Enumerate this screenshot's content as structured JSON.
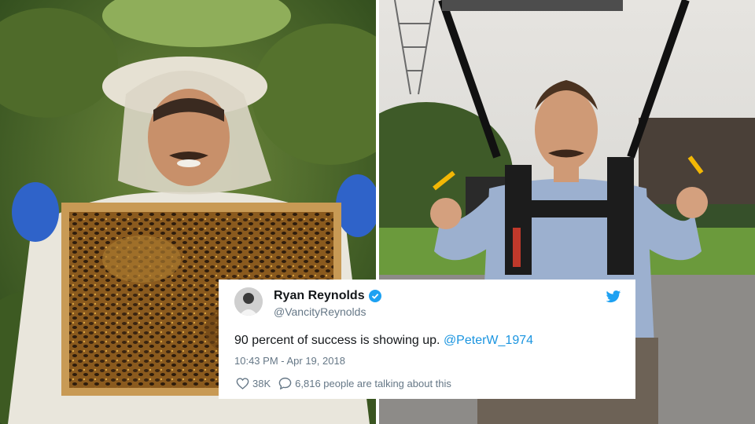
{
  "tweet": {
    "display_name": "Ryan Reynolds",
    "handle": "@VancityReynolds",
    "text": "90 percent of success is showing up.",
    "mention": "@PeterW_1974",
    "timestamp": "10:43 PM - Apr 19, 2018",
    "likes": "38K",
    "replies_text": "6,816 people are talking about this",
    "icons": [
      "verified-icon",
      "twitter-bird-icon",
      "heart-icon",
      "reply-bubble-icon"
    ],
    "accent_color": "#1da1f2"
  }
}
